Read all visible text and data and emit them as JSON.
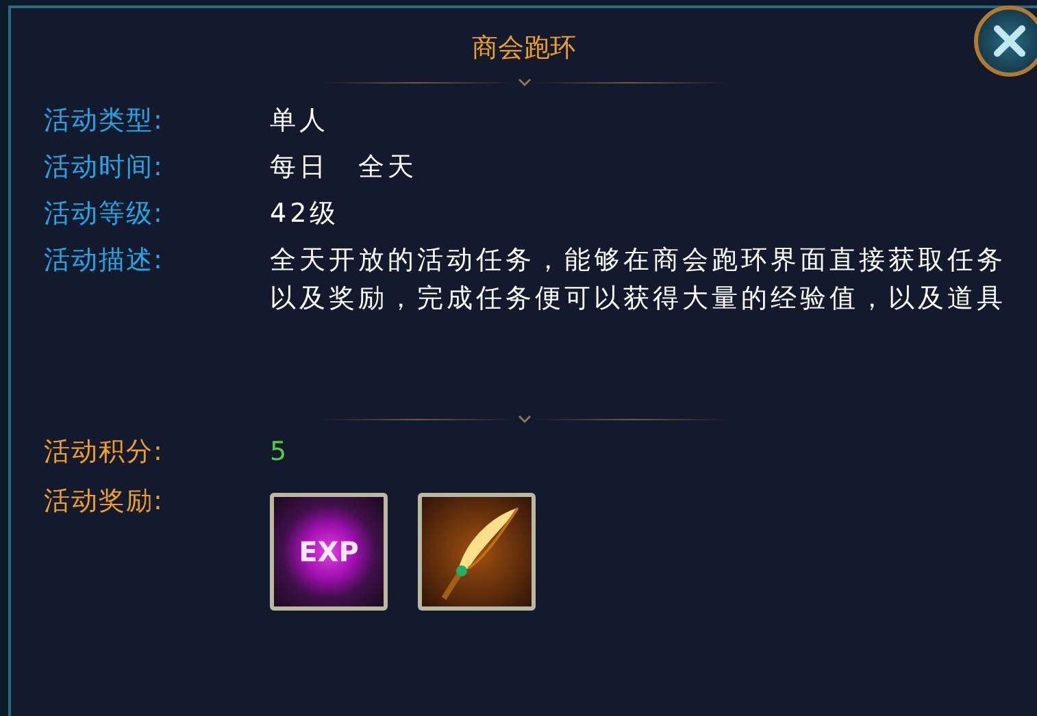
{
  "window": {
    "title": "商会跑环"
  },
  "info": [
    {
      "label": "活动类型:",
      "value": "单人",
      "kind": "text"
    },
    {
      "label": "活动时间:",
      "value": "每日　全天",
      "kind": "text"
    },
    {
      "label": "活动等级:",
      "value": "42级",
      "kind": "text"
    },
    {
      "label": "活动描述:",
      "value": "全天开放的活动任务，能够在商会跑环界面直接获取任务以及奖励，完成任务便可以获得大量的经验值，以及道具",
      "kind": "text"
    }
  ],
  "score": {
    "label": "活动积分:",
    "value": "5"
  },
  "rewards": {
    "label": "活动奖励:",
    "items": [
      {
        "kind": "exp",
        "label": "EXP"
      },
      {
        "kind": "feather"
      }
    ]
  }
}
